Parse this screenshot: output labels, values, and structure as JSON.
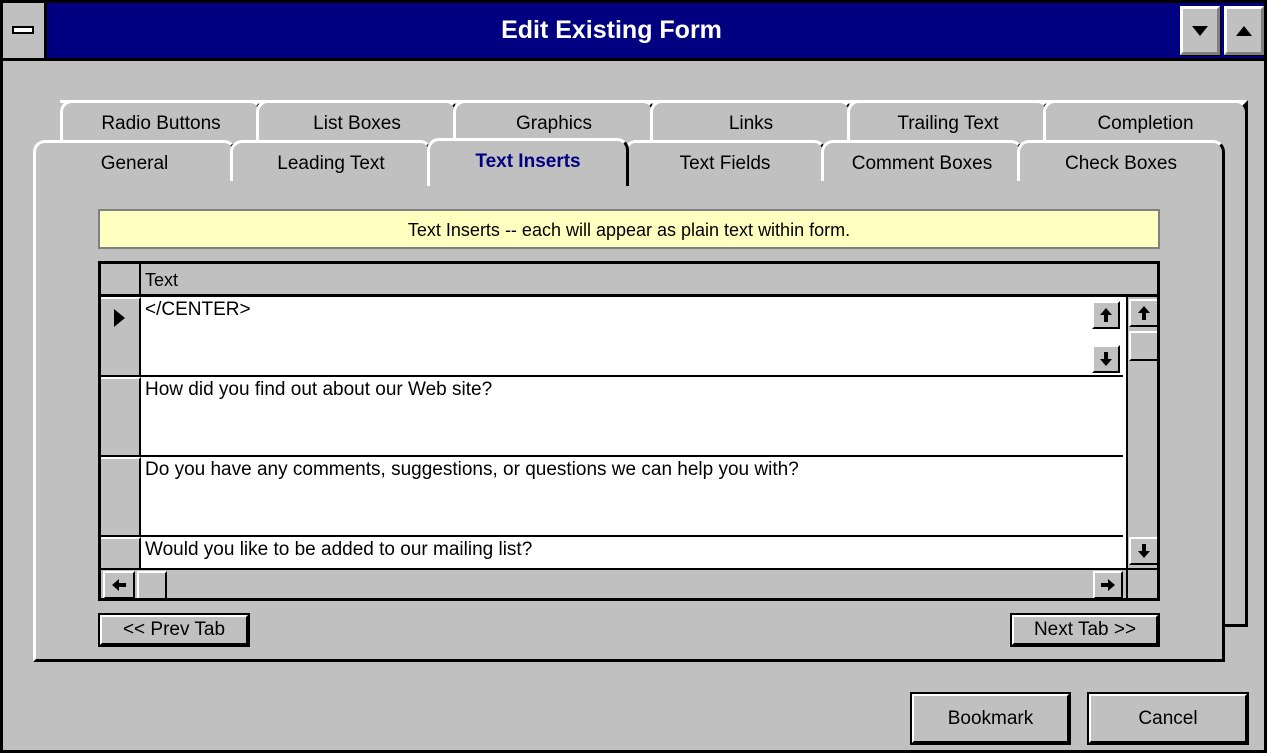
{
  "window": {
    "title": "Edit Existing Form"
  },
  "tabs": {
    "row1": [
      "Radio Buttons",
      "List Boxes",
      "Graphics",
      "Links",
      "Trailing Text",
      "Completion"
    ],
    "row2": [
      "General",
      "Leading Text",
      "Text Inserts",
      "Text Fields",
      "Comment Boxes",
      "Check Boxes"
    ],
    "active": "Text Inserts"
  },
  "info_bar": "Text Inserts -- each will appear as plain text within form.",
  "grid": {
    "column_header": "Text",
    "rows": [
      "</CENTER>",
      "How did you find out about our Web site?",
      "Do you have any comments, suggestions, or questions we can help you with?",
      "Would you like to be added to our mailing list?"
    ]
  },
  "nav": {
    "prev_label": "<< Prev Tab",
    "next_label": "Next Tab >>"
  },
  "footer": {
    "bookmark_label": "Bookmark",
    "cancel_label": "Cancel"
  },
  "colors": {
    "titlebar": "#000080",
    "active_tab_text": "#000080",
    "info_bg": "#ffffc0",
    "face": "#c0c0c0"
  }
}
